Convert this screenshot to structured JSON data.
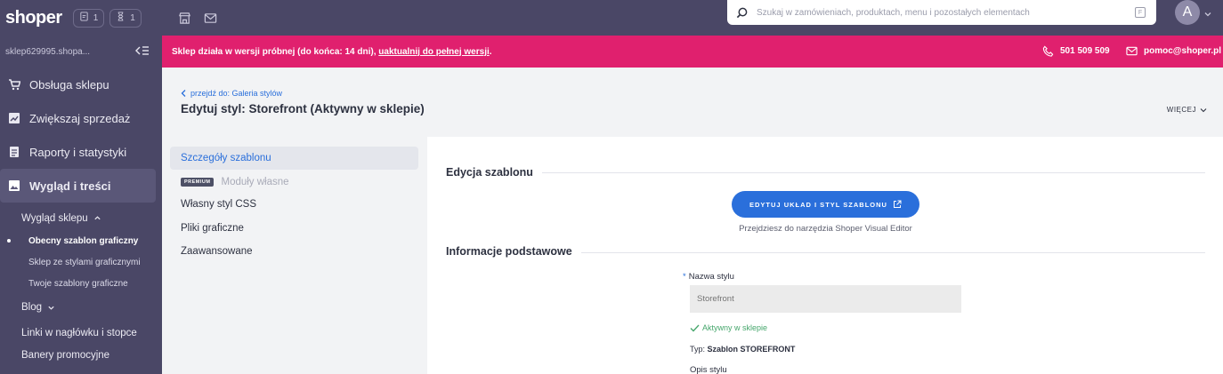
{
  "topbar": {
    "logo": "shoper",
    "chip_orders_count": "1",
    "chip_pending_count": "1",
    "search_placeholder": "Szukaj w zamówieniach, produktach, menu i pozostałych elementach",
    "search_shortcut": "F",
    "avatar_letter": "A"
  },
  "sidebar": {
    "shop_name": "sklep629995.shopa...",
    "items": [
      {
        "label": "Obsługa sklepu",
        "icon": "cart-icon"
      },
      {
        "label": "Zwiększaj sprzedaż",
        "icon": "chart-icon"
      },
      {
        "label": "Raporty i statystyki",
        "icon": "report-icon"
      },
      {
        "label": "Wygląd i treści",
        "icon": "image-icon"
      }
    ],
    "submenu_title": "Wygląd sklepu",
    "submenu": [
      {
        "label": "Obecny szablon graficzny"
      },
      {
        "label": "Sklep ze stylami graficznymi"
      },
      {
        "label": "Twoje szablony graficzne"
      }
    ],
    "blog_label": "Blog",
    "links_label": "Linki w nagłówku i stopce",
    "banners_label": "Banery promocyjne"
  },
  "banner": {
    "message": "Sklep działa w wersji próbnej (do końca: 14 dni),",
    "link": "uaktualnij do pełnej wersji",
    "suffix": ".",
    "phone": "501 509 509",
    "email": "pomoc@shoper.pl"
  },
  "header": {
    "breadcrumb": "przejdź do: Galeria stylów",
    "title": "Edytuj styl: Storefront (Aktywny w sklepie)",
    "more": "WIĘCEJ"
  },
  "tabs": [
    {
      "label": "Szczegóły szablonu"
    },
    {
      "label": "Moduły własne",
      "badge": "PREMIUM"
    },
    {
      "label": "Własny styl CSS"
    },
    {
      "label": "Pliki graficzne"
    },
    {
      "label": "Zaawansowane"
    }
  ],
  "main": {
    "section_edit": "Edycja szablonu",
    "edit_button": "EDYTUJ UKŁAD I STYL SZABLONU",
    "edit_hint": "Przejdziesz do narzędzia Shoper Visual Editor",
    "section_basic": "Informacje podstawowe",
    "name_label": "Nazwa stylu",
    "name_required": "*",
    "name_placeholder": "Storefront",
    "status": "Aktywny w sklepie",
    "type_prefix": "Typ:",
    "type_value": "Szablon STOREFRONT",
    "desc_label": "Opis stylu"
  },
  "colors": {
    "sidebar_bg": "#4a4766",
    "banner_bg": "#e0206e",
    "accent": "#2a6fdb",
    "success": "#45a66b"
  }
}
